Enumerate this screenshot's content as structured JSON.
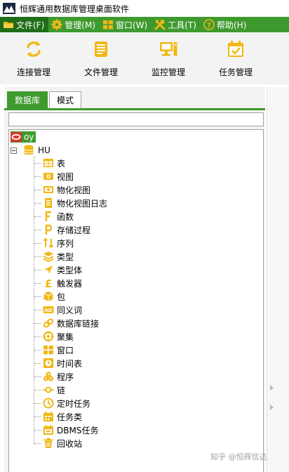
{
  "window": {
    "title": "恒辉通用数据库管理桌面软件"
  },
  "menu": [
    {
      "label": "文件(F)",
      "icon": "folder-icon",
      "active": true
    },
    {
      "label": "管理(M)",
      "icon": "gear-icon"
    },
    {
      "label": "窗口(W)",
      "icon": "windows-icon"
    },
    {
      "label": "工具(T)",
      "icon": "tools-icon"
    },
    {
      "label": "帮助(H)",
      "icon": "help-icon"
    }
  ],
  "toolbar": [
    {
      "label": "连接管理",
      "icon": "refresh-arrows-icon"
    },
    {
      "label": "文件管理",
      "icon": "file-stack-icon"
    },
    {
      "label": "监控管理",
      "icon": "monitor-icon"
    },
    {
      "label": "任务管理",
      "icon": "calendar-check-icon"
    }
  ],
  "tabs": [
    {
      "label": "数据库",
      "active": true
    },
    {
      "label": "模式",
      "active": false
    }
  ],
  "tree": {
    "connection": "oy",
    "database": "HU",
    "items": [
      {
        "label": "表",
        "icon": "table-icon"
      },
      {
        "label": "视图",
        "icon": "view-icon"
      },
      {
        "label": "物化视图",
        "icon": "materialized-view-icon"
      },
      {
        "label": "物化视图日志",
        "icon": "log-icon"
      },
      {
        "label": "函数",
        "icon": "function-icon"
      },
      {
        "label": "存储过程",
        "icon": "procedure-icon"
      },
      {
        "label": "序列",
        "icon": "sequence-icon"
      },
      {
        "label": "类型",
        "icon": "type-layers-icon"
      },
      {
        "label": "类型体",
        "icon": "type-body-icon"
      },
      {
        "label": "触发器",
        "icon": "trigger-icon"
      },
      {
        "label": "包",
        "icon": "package-icon"
      },
      {
        "label": "同义词",
        "icon": "synonym-icon"
      },
      {
        "label": "数据库链接",
        "icon": "link-icon"
      },
      {
        "label": "聚集",
        "icon": "cluster-icon"
      },
      {
        "label": "窗口",
        "icon": "window-icon"
      },
      {
        "label": "时间表",
        "icon": "schedule-icon"
      },
      {
        "label": "程序",
        "icon": "program-icon"
      },
      {
        "label": "链",
        "icon": "chain-icon"
      },
      {
        "label": "定时任务",
        "icon": "timer-icon"
      },
      {
        "label": "任务类",
        "icon": "job-class-icon"
      },
      {
        "label": "DBMS任务",
        "icon": "dbms-job-icon"
      },
      {
        "label": "回收站",
        "icon": "recycle-bin-icon"
      }
    ]
  },
  "watermark": "知乎 @恒辉信达",
  "colors": {
    "accent": "#3f9a2e",
    "accent_dark": "#1f6e17",
    "icon": "#f2b713"
  }
}
